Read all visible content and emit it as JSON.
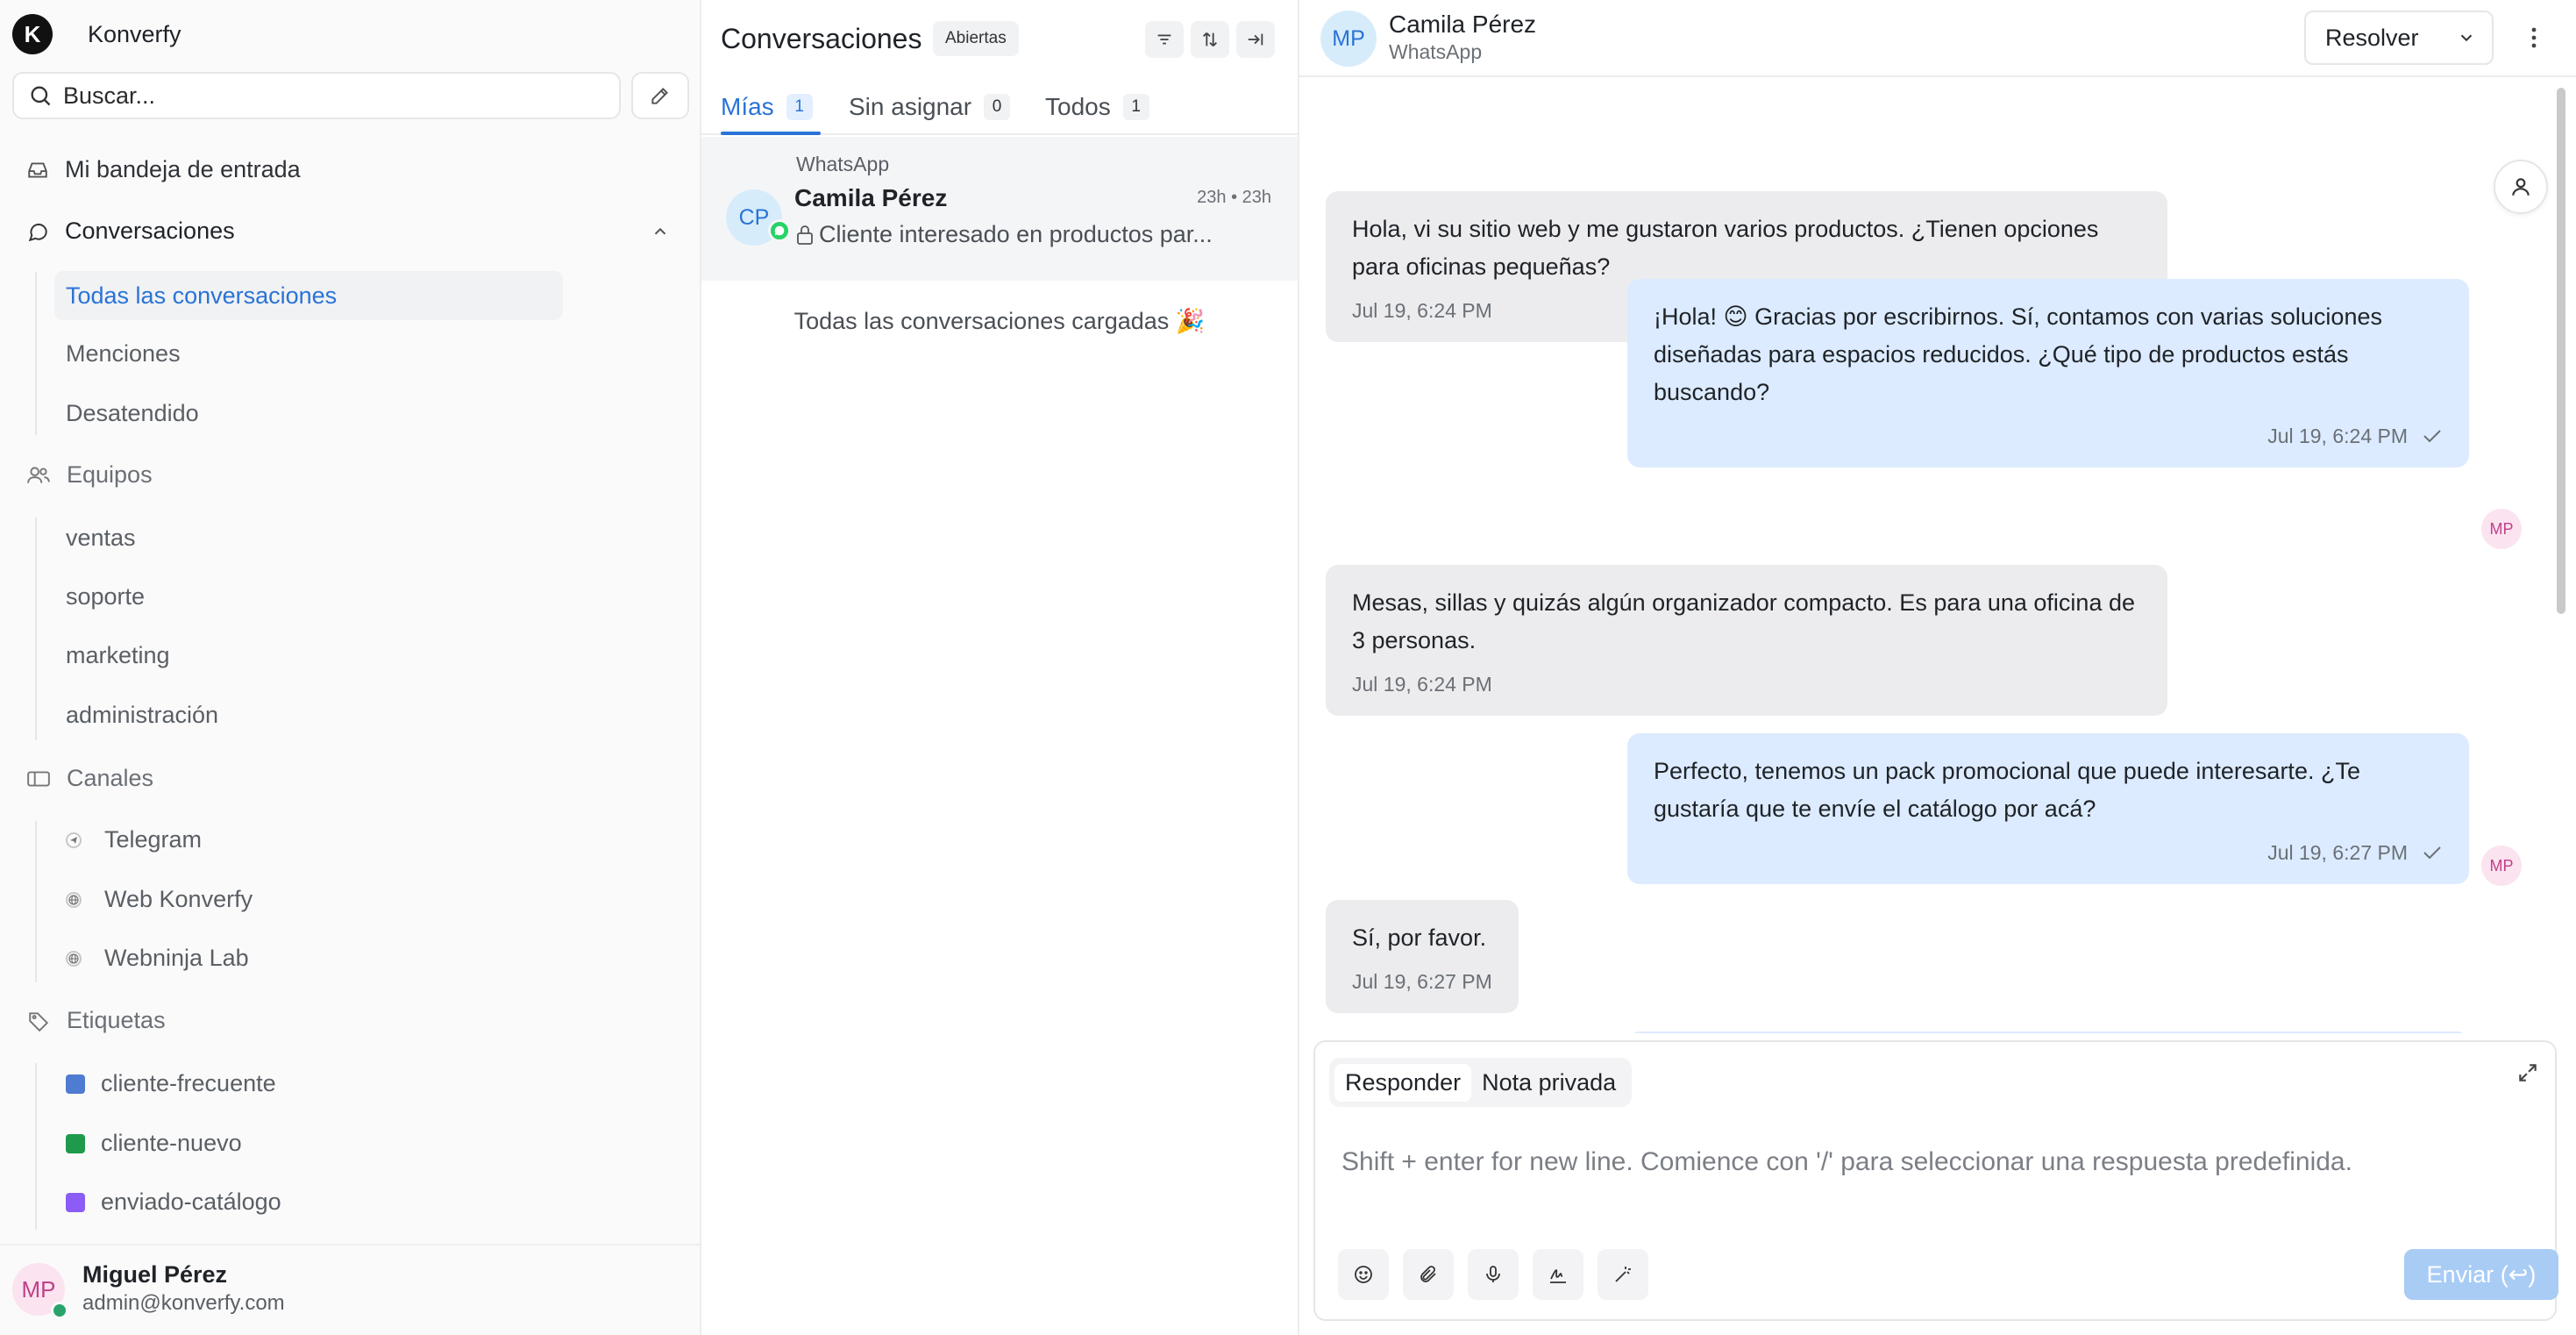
{
  "app": {
    "name": "Konverfy",
    "logo_letter": "K"
  },
  "sidebar": {
    "search_placeholder": "Buscar...",
    "inbox_label": "Mi bandeja de entrada",
    "conversations_group": "Conversaciones",
    "conversation_items": [
      "Todas las conversaciones",
      "Menciones",
      "Desatendido"
    ],
    "teams_group": "Equipos",
    "teams": [
      "ventas",
      "soporte",
      "marketing",
      "administración"
    ],
    "channels_group": "Canales",
    "channels": [
      "Telegram",
      "Web Konverfy",
      "Webninja Lab"
    ],
    "labels_group": "Etiquetas",
    "labels": [
      {
        "name": "cliente-frecuente",
        "color": "#4f7bd0"
      },
      {
        "name": "cliente-nuevo",
        "color": "#1f9a4c"
      },
      {
        "name": "enviado-catálogo",
        "color": "#8b5cf6"
      }
    ],
    "profile": {
      "initials": "MP",
      "name": "Miguel Pérez",
      "email": "admin@konverfy.com"
    }
  },
  "list": {
    "title": "Conversaciones",
    "status_badge": "Abiertas",
    "tabs": [
      {
        "label": "Mías",
        "count": "1"
      },
      {
        "label": "Sin asignar",
        "count": "0"
      },
      {
        "label": "Todos",
        "count": "1"
      }
    ],
    "conversation": {
      "inbox": "WhatsApp",
      "initials": "CP",
      "name": "Camila Pérez",
      "time": "23h • 23h",
      "preview": "Cliente interesado en productos par..."
    },
    "all_loaded": "Todas las conversaciones cargadas 🎉"
  },
  "chat": {
    "contact": {
      "initials": "MP",
      "name": "Camila Pérez",
      "channel": "WhatsApp"
    },
    "resolve_label": "Resolver",
    "messages": [
      {
        "dir": "in",
        "text": "Hola, vi su sitio web y me gustaron varios productos. ¿Tienen opciones para oficinas pequeñas?",
        "time": "Jul 19, 6:24 PM"
      },
      {
        "dir": "out",
        "text": "¡Hola! 😊 Gracias por escribirnos. Sí, contamos con varias soluciones diseñadas para espacios reducidos. ¿Qué tipo de productos estás buscando?",
        "time": "Jul 19, 6:24 PM",
        "agent_initials": "MP"
      },
      {
        "dir": "in",
        "text": "Mesas, sillas y quizás algún organizador compacto. Es para una oficina de 3 personas.",
        "time": "Jul 19, 6:24 PM"
      },
      {
        "dir": "out",
        "text": "Perfecto, tenemos un pack promocional que puede interesarte. ¿Te gustaría que te envíe el catálogo por acá?",
        "time": "Jul 19, 6:27 PM",
        "agent_initials": "MP"
      },
      {
        "dir": "in",
        "text": "Sí, por favor.",
        "time": "Jul 19, 6:27 PM"
      }
    ],
    "composer": {
      "mode_reply": "Responder",
      "mode_note": "Nota privada",
      "placeholder": "Shift + enter for new line. Comience con '/' para seleccionar una respuesta predefinida.",
      "send_label": "Enviar (↩)"
    }
  }
}
